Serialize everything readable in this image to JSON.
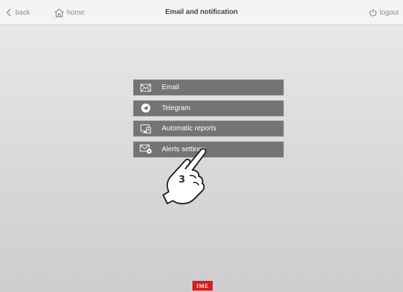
{
  "header": {
    "back_label": "back",
    "home_label": "home",
    "title": "Email and notification",
    "logout_label": "logout"
  },
  "menu": {
    "items": [
      {
        "label": "Email",
        "icon": "envelope-icon"
      },
      {
        "label": "Telegram",
        "icon": "telegram-icon"
      },
      {
        "label": "Automatic reports",
        "icon": "report-icon"
      },
      {
        "label": "Alerts settings",
        "icon": "alert-envelope-icon"
      }
    ]
  },
  "annotation": {
    "step_number": "3",
    "icon": "pointing-hand-icon"
  },
  "footer": {
    "logo_text": "IME",
    "logo_color": "#d61d1d"
  },
  "colors": {
    "menu_item_bg": "#747474",
    "topbar_bg": "#f4f4f4"
  }
}
